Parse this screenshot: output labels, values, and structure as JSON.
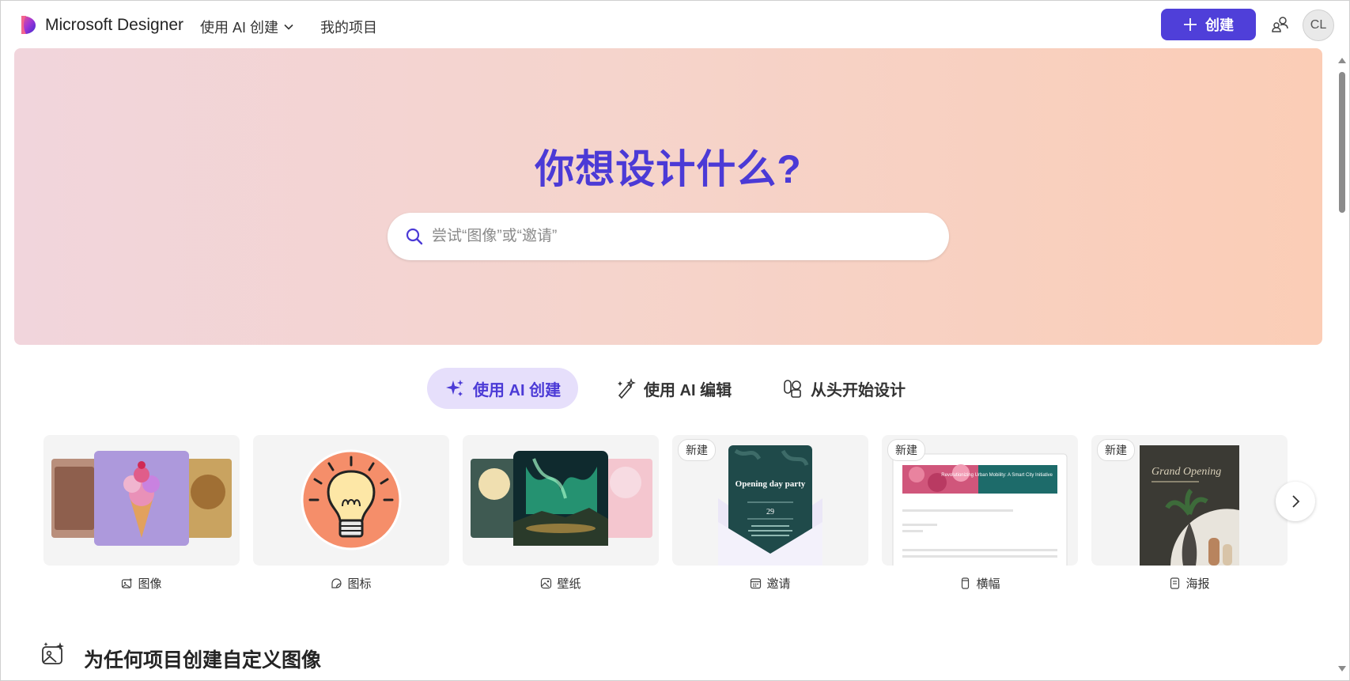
{
  "header": {
    "brand": "Microsoft Designer",
    "nav_ai_create": "使用 AI 创建",
    "nav_projects": "我的项目",
    "create_button": "创建",
    "avatar_initials": "CL"
  },
  "hero": {
    "title": "你想设计什么?",
    "search_placeholder": "尝试“图像”或“邀请”"
  },
  "tabs": [
    {
      "label": "使用 AI 创建",
      "icon": "sparkle-icon",
      "active": true
    },
    {
      "label": "使用 AI 编辑",
      "icon": "magic-pen-icon",
      "active": false
    },
    {
      "label": "从头开始设计",
      "icon": "shapes-icon",
      "active": false
    }
  ],
  "cards": [
    {
      "label": "图像",
      "icon": "image-sparkle-icon",
      "badge": ""
    },
    {
      "label": "图标",
      "icon": "sticker-icon",
      "badge": ""
    },
    {
      "label": "壁纸",
      "icon": "wallpaper-icon",
      "badge": ""
    },
    {
      "label": "邀请",
      "icon": "calendar-icon",
      "badge": "新建",
      "thumb_text_1": "Opening day party",
      "thumb_text_2": "29"
    },
    {
      "label": "横幅",
      "icon": "phone-icon",
      "badge": "新建",
      "thumb_text_1": "Revolutionizing Urban Mobility: A Smart City Initiative"
    },
    {
      "label": "海报",
      "icon": "document-icon",
      "badge": "新建",
      "thumb_text_1": "Grand Opening"
    }
  ],
  "section": {
    "title": "为任何项目创建自定义图像"
  },
  "colors": {
    "accent": "#4f3fd9",
    "hero_title": "#4b3ad6",
    "tab_active_bg": "#e6dffb"
  }
}
